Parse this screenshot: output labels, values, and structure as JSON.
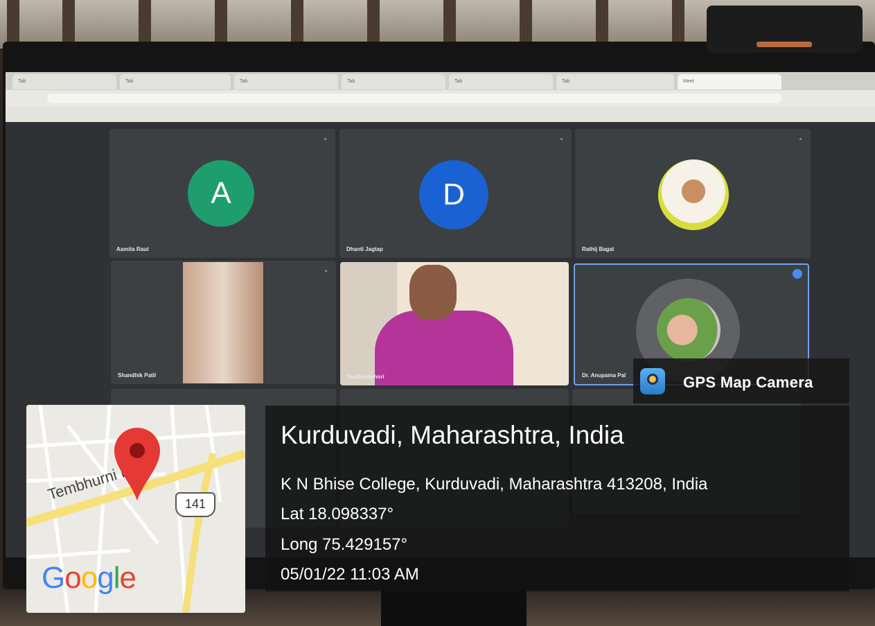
{
  "meet": {
    "participants": [
      {
        "name": "Aamita Raut",
        "initial": "A",
        "color": "#1e9e6e"
      },
      {
        "name": "Dhanti Jagtap",
        "initial": "D",
        "color": "#1a62d3"
      },
      {
        "name": "Rathij Bagal"
      },
      {
        "name": "Shandhik Patil"
      },
      {
        "name": "Sudhantishori"
      },
      {
        "name": "Dr. Anupama Pal"
      }
    ]
  },
  "browser": {
    "tabs": [
      "Tab",
      "Tab",
      "Tab",
      "Tab",
      "Tab",
      "Tab",
      "Meet"
    ]
  },
  "overlay": {
    "app_name": "GPS Map Camera",
    "location_title": "Kurduvadi, Maharashtra, India",
    "address": "K N Bhise College, Kurduvadi, Maharashtra 413208, India",
    "lat": "Lat 18.098337°",
    "long": "Long 75.429157°",
    "datetime": "05/01/22 11:03 AM"
  },
  "map": {
    "road_label": "Tembhurni Rd",
    "highway_number": "141",
    "logo": "Google",
    "pin_color": "#e53935"
  }
}
